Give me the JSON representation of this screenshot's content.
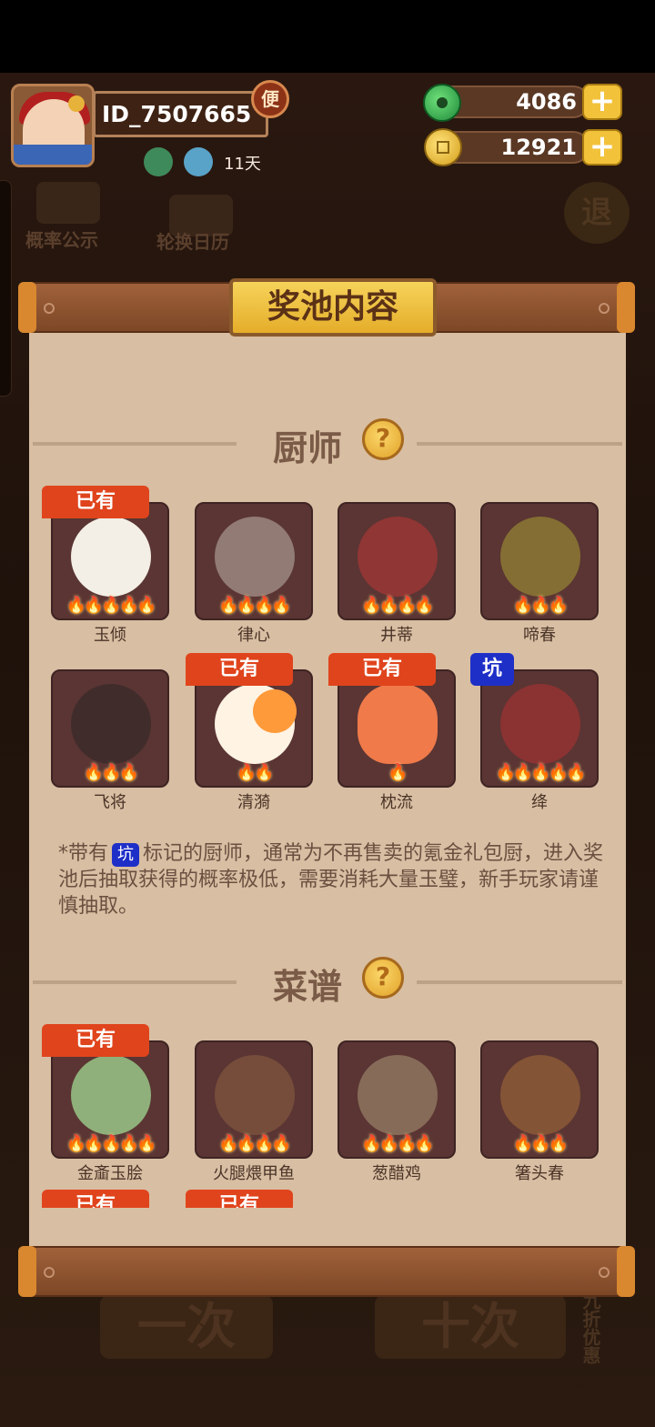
{
  "header": {
    "user_id": "ID_7507665",
    "badge": "便",
    "buff_days": "11天",
    "jade": "4086",
    "coins": "12921",
    "plus": "+"
  },
  "background": {
    "prob_label": "概率公示",
    "rotation_label": "轮换日历",
    "exit_label": "退",
    "single_draw": "一次",
    "ten_draw": "十次",
    "discount": "九折优惠"
  },
  "panel": {
    "title": "奖池内容",
    "help": "?"
  },
  "chefs": {
    "section_title": "厨师",
    "items": [
      {
        "name": "玉倾",
        "owned": true,
        "stars": 5
      },
      {
        "name": "律心",
        "owned": false,
        "stars": 4
      },
      {
        "name": "井蒂",
        "owned": false,
        "stars": 4
      },
      {
        "name": "啼春",
        "owned": false,
        "stars": 3
      },
      {
        "name": "飞将",
        "owned": false,
        "stars": 3
      },
      {
        "name": "清漪",
        "owned": true,
        "stars": 2
      },
      {
        "name": "枕流",
        "owned": true,
        "stars": 1
      },
      {
        "name": "绛",
        "owned": false,
        "pit": true,
        "stars": 5
      }
    ],
    "owned_tag": "已有",
    "pit_tag": "坑"
  },
  "note": {
    "prefix": "*带有",
    "pit": "坑",
    "text": "标记的厨师，通常为不再售卖的氪金礼包厨，进入奖池后抽取获得的概率极低，需要消耗大量玉璧，新手玩家请谨慎抽取。"
  },
  "recipes": {
    "section_title": "菜谱",
    "items": [
      {
        "name": "金齑玉脍",
        "owned": true,
        "stars": 5
      },
      {
        "name": "火腿煨甲鱼",
        "owned": false,
        "stars": 4
      },
      {
        "name": "葱醋鸡",
        "owned": false,
        "stars": 4
      },
      {
        "name": "箸头春",
        "owned": false,
        "stars": 3
      }
    ],
    "owned_tag": "已有",
    "partial_owned_tag": "已有"
  },
  "colors": {
    "owned_tag": "#e0441c",
    "pit_tag": "#1e2fc8",
    "paper": "#d8bea2",
    "plaque": "#f2c23a"
  }
}
